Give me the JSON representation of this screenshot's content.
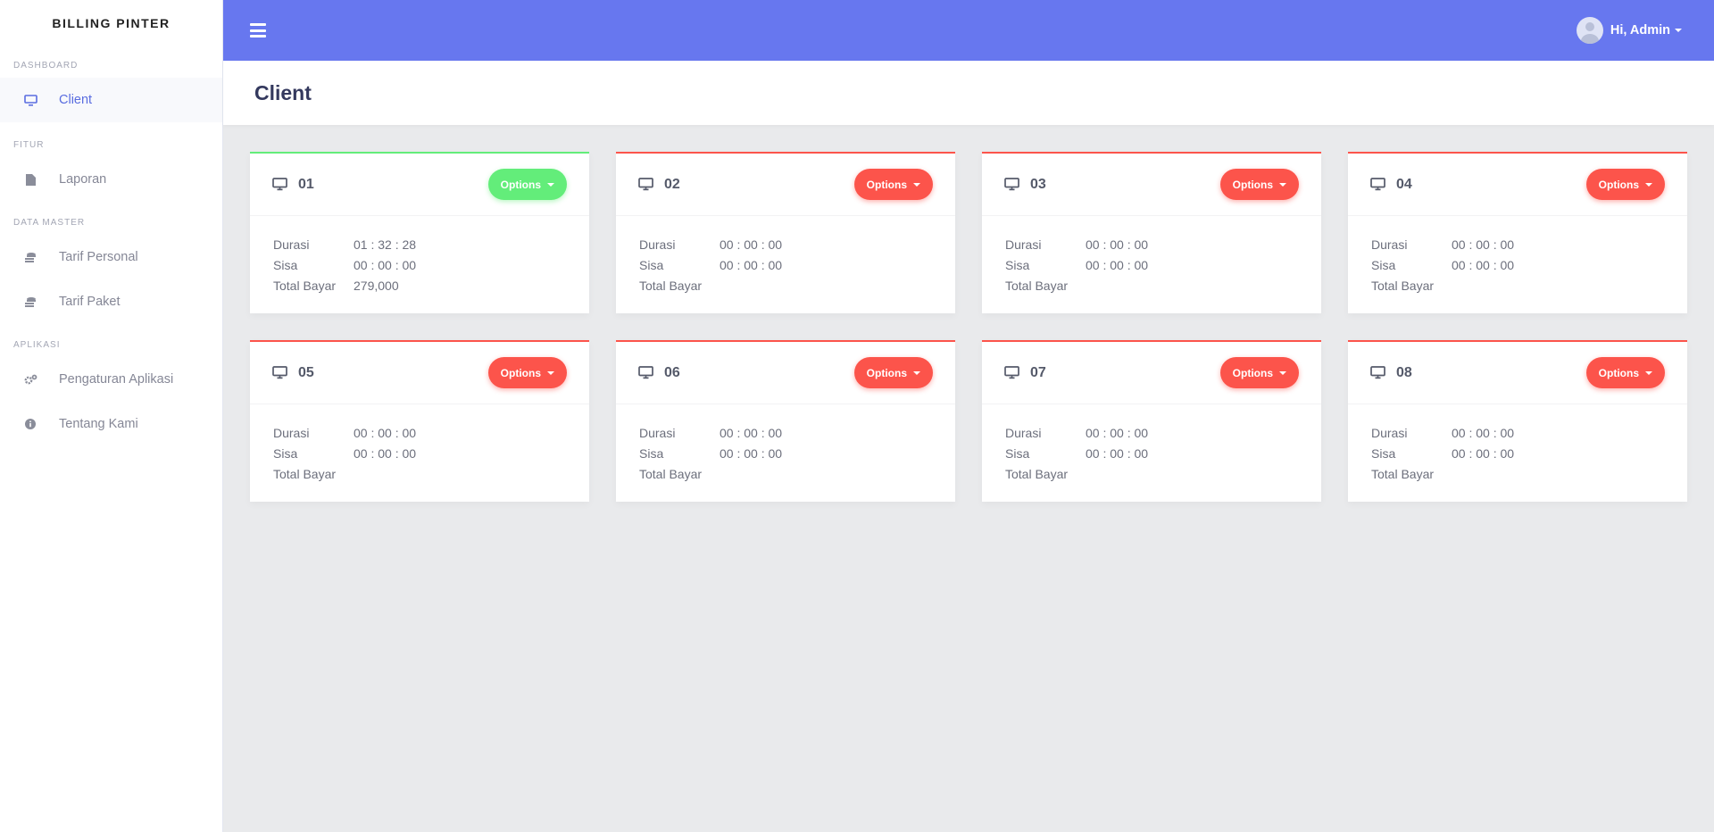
{
  "brand": "BILLING PINTER",
  "sidebar": {
    "sections": [
      {
        "heading": "DASHBOARD",
        "items": [
          {
            "label": "Client",
            "icon": "desktop-icon"
          }
        ]
      },
      {
        "heading": "FITUR",
        "items": [
          {
            "label": "Laporan",
            "icon": "file-icon"
          }
        ]
      },
      {
        "heading": "DATA MASTER",
        "items": [
          {
            "label": "Tarif Personal",
            "icon": "coins-icon"
          },
          {
            "label": "Tarif Paket",
            "icon": "coins-icon"
          }
        ]
      },
      {
        "heading": "APLIKASI",
        "items": [
          {
            "label": "Pengaturan Aplikasi",
            "icon": "cogs-icon"
          },
          {
            "label": "Tentang Kami",
            "icon": "info-circle-icon"
          }
        ]
      }
    ]
  },
  "topbar": {
    "user_label": "Hi, Admin"
  },
  "page": {
    "title": "Client"
  },
  "labels": {
    "durasi": "Durasi",
    "sisa": "Sisa",
    "total_bayar": "Total Bayar",
    "options": "Options"
  },
  "clients": [
    {
      "name": "01",
      "durasi": "01 : 32 : 28",
      "sisa": "00 : 00 : 00",
      "total_bayar": "279,000",
      "status": "active"
    },
    {
      "name": "02",
      "durasi": "00 : 00 : 00",
      "sisa": "00 : 00 : 00",
      "total_bayar": "",
      "status": "inactive"
    },
    {
      "name": "03",
      "durasi": "00 : 00 : 00",
      "sisa": "00 : 00 : 00",
      "total_bayar": "",
      "status": "inactive"
    },
    {
      "name": "04",
      "durasi": "00 : 00 : 00",
      "sisa": "00 : 00 : 00",
      "total_bayar": "",
      "status": "inactive"
    },
    {
      "name": "05",
      "durasi": "00 : 00 : 00",
      "sisa": "00 : 00 : 00",
      "total_bayar": "",
      "status": "inactive"
    },
    {
      "name": "06",
      "durasi": "00 : 00 : 00",
      "sisa": "00 : 00 : 00",
      "total_bayar": "",
      "status": "inactive"
    },
    {
      "name": "07",
      "durasi": "00 : 00 : 00",
      "sisa": "00 : 00 : 00",
      "total_bayar": "",
      "status": "inactive"
    },
    {
      "name": "08",
      "durasi": "00 : 00 : 00",
      "sisa": "00 : 00 : 00",
      "total_bayar": "",
      "status": "inactive"
    }
  ],
  "colors": {
    "primary": "#6777ef",
    "success": "#63ed7a",
    "danger": "#fc544b",
    "sidebar_active": "#5a6de0"
  }
}
